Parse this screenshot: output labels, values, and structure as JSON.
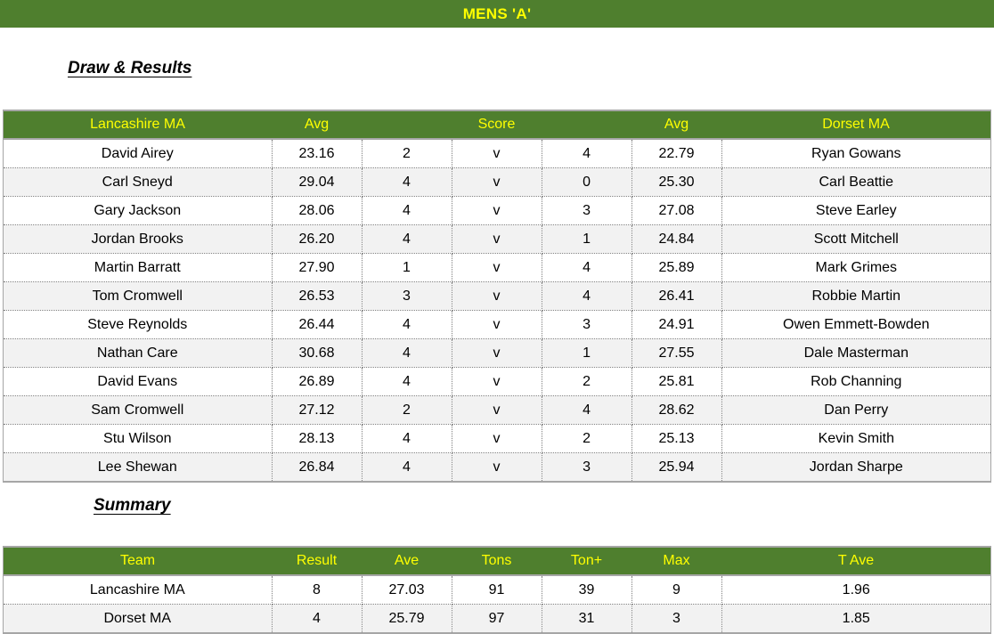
{
  "title": "MENS 'A'",
  "colors": {
    "header_green": "#4f7f2e",
    "header_text_yellow": "#ffff00",
    "row_alt": "#f2f2f2",
    "border_gray": "#a6a6a6"
  },
  "sections": {
    "draw_heading": "Draw & Results",
    "summary_heading": "Summary"
  },
  "draw_table": {
    "headers": [
      "Lancashire MA",
      "Avg",
      "Score",
      "Avg",
      "Dorset MA"
    ],
    "rows": [
      {
        "home": "David Airey",
        "home_avg": "23.16",
        "home_score": "2",
        "v": "v",
        "away_score": "4",
        "away_avg": "22.79",
        "away": "Ryan Gowans"
      },
      {
        "home": "Carl Sneyd",
        "home_avg": "29.04",
        "home_score": "4",
        "v": "v",
        "away_score": "0",
        "away_avg": "25.30",
        "away": "Carl Beattie"
      },
      {
        "home": "Gary Jackson",
        "home_avg": "28.06",
        "home_score": "4",
        "v": "v",
        "away_score": "3",
        "away_avg": "27.08",
        "away": "Steve Earley"
      },
      {
        "home": "Jordan Brooks",
        "home_avg": "26.20",
        "home_score": "4",
        "v": "v",
        "away_score": "1",
        "away_avg": "24.84",
        "away": "Scott Mitchell"
      },
      {
        "home": "Martin Barratt",
        "home_avg": "27.90",
        "home_score": "1",
        "v": "v",
        "away_score": "4",
        "away_avg": "25.89",
        "away": "Mark Grimes"
      },
      {
        "home": "Tom Cromwell",
        "home_avg": "26.53",
        "home_score": "3",
        "v": "v",
        "away_score": "4",
        "away_avg": "26.41",
        "away": "Robbie Martin"
      },
      {
        "home": "Steve Reynolds",
        "home_avg": "26.44",
        "home_score": "4",
        "v": "v",
        "away_score": "3",
        "away_avg": "24.91",
        "away": "Owen Emmett-Bowden"
      },
      {
        "home": "Nathan Care",
        "home_avg": "30.68",
        "home_score": "4",
        "v": "v",
        "away_score": "1",
        "away_avg": "27.55",
        "away": "Dale Masterman"
      },
      {
        "home": "David Evans",
        "home_avg": "26.89",
        "home_score": "4",
        "v": "v",
        "away_score": "2",
        "away_avg": "25.81",
        "away": "Rob Channing"
      },
      {
        "home": "Sam Cromwell",
        "home_avg": "27.12",
        "home_score": "2",
        "v": "v",
        "away_score": "4",
        "away_avg": "28.62",
        "away": "Dan Perry"
      },
      {
        "home": "Stu Wilson",
        "home_avg": "28.13",
        "home_score": "4",
        "v": "v",
        "away_score": "2",
        "away_avg": "25.13",
        "away": "Kevin Smith"
      },
      {
        "home": "Lee Shewan",
        "home_avg": "26.84",
        "home_score": "4",
        "v": "v",
        "away_score": "3",
        "away_avg": "25.94",
        "away": "Jordan Sharpe"
      }
    ]
  },
  "summary_table": {
    "headers": [
      "Team",
      "Result",
      "Ave",
      "Tons",
      "Ton+",
      "Max",
      "T Ave"
    ],
    "rows": [
      {
        "team": "Lancashire MA",
        "result": "8",
        "ave": "27.03",
        "tons": "91",
        "tonplus": "39",
        "max": "9",
        "tave": "1.96"
      },
      {
        "team": "Dorset MA",
        "result": "4",
        "ave": "25.79",
        "tons": "97",
        "tonplus": "31",
        "max": "3",
        "tave": "1.85"
      }
    ]
  }
}
